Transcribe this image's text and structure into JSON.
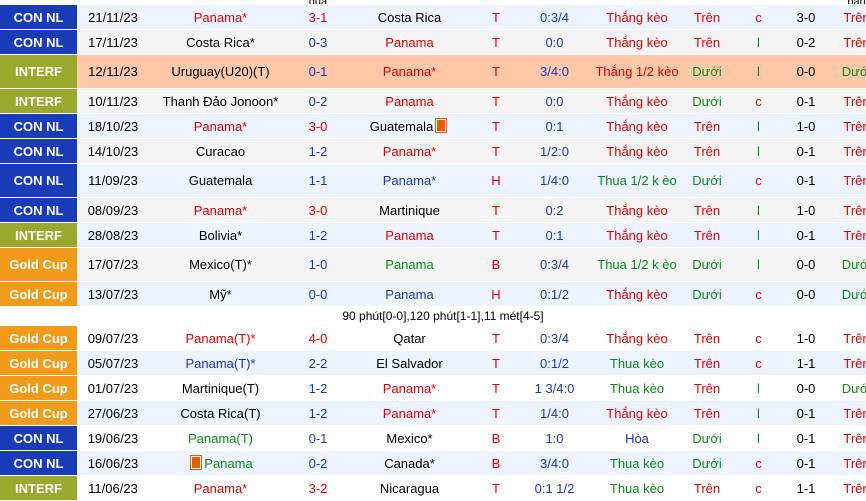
{
  "header": [
    "",
    "",
    "",
    "quả",
    "",
    "",
    "",
    "",
    "",
    "ban"
  ],
  "league_colors": {
    "CON NL": "#1a3bb8",
    "INTERF": "#9aa82e",
    "Gold Cup": "#f29a1a"
  },
  "rows": [
    {
      "league": "CON NL",
      "date": "21/11/23",
      "home": "Panama*",
      "home_color": "red",
      "score": "3-1",
      "score_color": "red",
      "away": "Costa Rica",
      "away_color": "black",
      "ha": "T",
      "odds": "0:3/4",
      "result": "Thắng kèo",
      "result_color": "red",
      "ou": "Trên",
      "ou_color": "red",
      "cl": "c",
      "cl_color": "red",
      "ht": "3-0",
      "ht2": "Trên",
      "ht2_color": "red",
      "style": "alt"
    },
    {
      "league": "CON NL",
      "date": "17/11/23",
      "home": "Costa Rica*",
      "home_color": "black",
      "score": "0-3",
      "score_color": "blue",
      "away": "Panama",
      "away_color": "red",
      "ha": "T",
      "odds": "0:0",
      "result": "Thắng kèo",
      "result_color": "red",
      "ou": "Trên",
      "ou_color": "red",
      "cl": "l",
      "cl_color": "green",
      "ht": "0-2",
      "ht2": "Trên",
      "ht2_color": "red",
      "style": ""
    },
    {
      "league": "INTERF",
      "date": "12/11/23",
      "home": "Uruguay(U20)(T)",
      "home_color": "black",
      "score": "0-1",
      "score_color": "blue",
      "away": "Panama*",
      "away_color": "red",
      "ha": "T",
      "odds": "3/4:0",
      "result": "Thắng 1/2 kèo",
      "result_color": "red",
      "ou": "Dưới",
      "ou_color": "green",
      "cl": "l",
      "cl_color": "green",
      "ht": "0-0",
      "ht2": "Dưới",
      "ht2_color": "green",
      "style": "hl",
      "tall": true
    },
    {
      "league": "INTERF",
      "date": "10/11/23",
      "home": "Thanh Đảo Jonoon*",
      "home_color": "black",
      "score": "0-2",
      "score_color": "blue",
      "away": "Panama",
      "away_color": "red",
      "ha": "T",
      "odds": "0:0",
      "result": "Thắng kèo",
      "result_color": "red",
      "ou": "Dưới",
      "ou_color": "green",
      "cl": "c",
      "cl_color": "red",
      "ht": "0-1",
      "ht2": "Trên",
      "ht2_color": "red",
      "style": ""
    },
    {
      "league": "CON NL",
      "date": "18/10/23",
      "home": "Panama*",
      "home_color": "red",
      "score": "3-0",
      "score_color": "red",
      "away": "Guatemala",
      "away_color": "black",
      "away_flag": true,
      "ha": "T",
      "odds": "0:1",
      "result": "Thắng kèo",
      "result_color": "red",
      "ou": "Trên",
      "ou_color": "red",
      "cl": "l",
      "cl_color": "green",
      "ht": "1-0",
      "ht2": "Trên",
      "ht2_color": "red",
      "style": "alt"
    },
    {
      "league": "CON NL",
      "date": "14/10/23",
      "home": "Curacao",
      "home_color": "black",
      "score": "1-2",
      "score_color": "blue",
      "away": "Panama*",
      "away_color": "red",
      "ha": "T",
      "odds": "1/2:0",
      "result": "Thắng kèo",
      "result_color": "red",
      "ou": "Trên",
      "ou_color": "red",
      "cl": "l",
      "cl_color": "green",
      "ht": "0-1",
      "ht2": "Trên",
      "ht2_color": "red",
      "style": ""
    },
    {
      "league": "CON NL",
      "date": "11/09/23",
      "home": "Guatemala",
      "home_color": "black",
      "score": "1-1",
      "score_color": "blue",
      "away": "Panama*",
      "away_color": "blue",
      "ha": "H",
      "odds": "1/4:0",
      "result": "Thua 1/2 k èo",
      "result_color": "green",
      "ou": "Dưới",
      "ou_color": "green",
      "cl": "c",
      "cl_color": "red",
      "ht": "0-1",
      "ht2": "Trên",
      "ht2_color": "red",
      "style": "alt",
      "tall": true
    },
    {
      "league": "CON NL",
      "date": "08/09/23",
      "home": "Panama*",
      "home_color": "red",
      "score": "3-0",
      "score_color": "red",
      "away": "Martinique",
      "away_color": "black",
      "ha": "T",
      "odds": "0:2",
      "result": "Thắng kèo",
      "result_color": "red",
      "ou": "Trên",
      "ou_color": "red",
      "cl": "l",
      "cl_color": "green",
      "ht": "1-0",
      "ht2": "Trên",
      "ht2_color": "red",
      "style": ""
    },
    {
      "league": "INTERF",
      "date": "28/08/23",
      "home": "Bolivia*",
      "home_color": "black",
      "score": "1-2",
      "score_color": "blue",
      "away": "Panama",
      "away_color": "red",
      "ha": "T",
      "odds": "0:1",
      "result": "Thắng kèo",
      "result_color": "red",
      "ou": "Trên",
      "ou_color": "red",
      "cl": "l",
      "cl_color": "green",
      "ht": "0-1",
      "ht2": "Trên",
      "ht2_color": "red",
      "style": "alt"
    },
    {
      "league": "Gold Cup",
      "date": "17/07/23",
      "home": "Mexico(T)*",
      "home_color": "black",
      "score": "1-0",
      "score_color": "blue",
      "away": "Panama",
      "away_color": "green",
      "ha": "B",
      "odds": "0:3/4",
      "result": "Thua 1/2 k èo",
      "result_color": "green",
      "ou": "Dưới",
      "ou_color": "green",
      "cl": "l",
      "cl_color": "green",
      "ht": "0-0",
      "ht2": "Dưới",
      "ht2_color": "green",
      "style": "",
      "tall": true
    },
    {
      "league": "Gold Cup",
      "date": "13/07/23",
      "home": "Mỹ*",
      "home_color": "black",
      "score": "0-0",
      "score_color": "blue",
      "away": "Panama",
      "away_color": "blue",
      "ha": "H",
      "odds": "0:1/2",
      "result": "Thắng kèo",
      "result_color": "red",
      "ou": "Dưới",
      "ou_color": "green",
      "cl": "c",
      "cl_color": "red",
      "ht": "0-0",
      "ht2": "Dưới",
      "ht2_color": "green",
      "style": "alt"
    },
    {
      "note": "90 phút[0-0],120 phút[1-1],11 mét[4-5]"
    },
    {
      "league": "Gold Cup",
      "date": "09/07/23",
      "home": "Panama(T)*",
      "home_color": "red",
      "score": "4-0",
      "score_color": "red",
      "away": "Qatar",
      "away_color": "black",
      "ha": "T",
      "odds": "0:3/4",
      "result": "Thắng kèo",
      "result_color": "red",
      "ou": "Trên",
      "ou_color": "red",
      "cl": "c",
      "cl_color": "red",
      "ht": "1-0",
      "ht2": "Trên",
      "ht2_color": "red",
      "style": ""
    },
    {
      "league": "Gold Cup",
      "date": "05/07/23",
      "home": "Panama(T)*",
      "home_color": "blue",
      "score": "2-2",
      "score_color": "blue",
      "away": "El Salvador",
      "away_color": "black",
      "ha": "T",
      "odds": "0:1/2",
      "result": "Thua kèo",
      "result_color": "green",
      "ou": "Trên",
      "ou_color": "red",
      "cl": "c",
      "cl_color": "red",
      "ht": "1-1",
      "ht2": "Trên",
      "ht2_color": "red",
      "style": "alt"
    },
    {
      "league": "Gold Cup",
      "date": "01/07/23",
      "home": "Martinique(T)",
      "home_color": "black",
      "score": "1-2",
      "score_color": "blue",
      "away": "Panama*",
      "away_color": "red",
      "ha": "T",
      "odds": "1 3/4:0",
      "result": "Thua kèo",
      "result_color": "green",
      "ou": "Trên",
      "ou_color": "red",
      "cl": "l",
      "cl_color": "green",
      "ht": "0-0",
      "ht2": "Dưới",
      "ht2_color": "green",
      "style": ""
    },
    {
      "league": "Gold Cup",
      "date": "27/06/23",
      "home": "Costa Rica(T)",
      "home_color": "black",
      "score": "1-2",
      "score_color": "blue",
      "away": "Panama*",
      "away_color": "red",
      "ha": "T",
      "odds": "1/4:0",
      "result": "Thắng kèo",
      "result_color": "red",
      "ou": "Trên",
      "ou_color": "red",
      "cl": "l",
      "cl_color": "green",
      "ht": "0-1",
      "ht2": "Trên",
      "ht2_color": "red",
      "style": "alt"
    },
    {
      "league": "CON NL",
      "date": "19/06/23",
      "home": "Panama(T)",
      "home_color": "green",
      "score": "0-1",
      "score_color": "blue",
      "away": "Mexico*",
      "away_color": "black",
      "ha": "B",
      "odds": "1:0",
      "result": "Hòa",
      "result_color": "blue",
      "ou": "Dưới",
      "ou_color": "green",
      "cl": "l",
      "cl_color": "green",
      "ht": "0-1",
      "ht2": "Trên",
      "ht2_color": "red",
      "style": ""
    },
    {
      "league": "CON NL",
      "date": "16/06/23",
      "home": "Panama",
      "home_color": "green",
      "home_flag": true,
      "score": "0-2",
      "score_color": "blue",
      "away": "Canada*",
      "away_color": "black",
      "ha": "B",
      "odds": "3/4:0",
      "result": "Thua kèo",
      "result_color": "green",
      "ou": "Dưới",
      "ou_color": "green",
      "cl": "c",
      "cl_color": "red",
      "ht": "0-1",
      "ht2": "Trên",
      "ht2_color": "red",
      "style": "alt"
    },
    {
      "league": "INTERF",
      "date": "11/06/23",
      "home": "Panama*",
      "home_color": "red",
      "score": "3-2",
      "score_color": "red",
      "away": "Nicaragua",
      "away_color": "black",
      "ha": "T",
      "odds": "0:1 1/2",
      "result": "Thua kèo",
      "result_color": "green",
      "ou": "Trên",
      "ou_color": "red",
      "cl": "c",
      "cl_color": "red",
      "ht": "1-1",
      "ht2": "Trên",
      "ht2_color": "red",
      "style": ""
    }
  ]
}
